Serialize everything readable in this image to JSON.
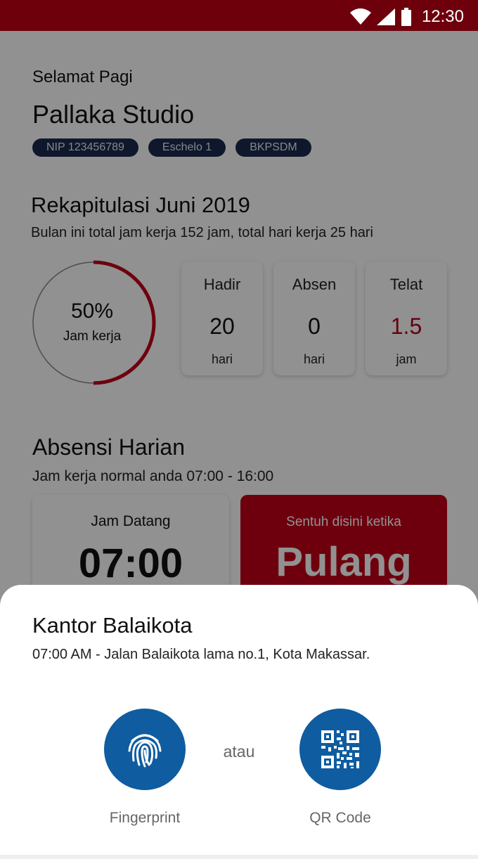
{
  "status_bar": {
    "time": "12:30",
    "background": "#6e000c"
  },
  "greeting": "Selamat Pagi",
  "user_name": "Pallaka Studio",
  "chips": [
    "NIP 123456789",
    "Eschelo 1",
    "BKPSDM"
  ],
  "rekap": {
    "title": "Rekapitulasi Juni 2019",
    "subtitle": "Bulan ini total jam kerja 152 jam, total hari kerja 25 hari",
    "progress_percent": 50,
    "progress_label": "50%",
    "progress_caption": "Jam kerja",
    "stats": [
      {
        "title": "Hadir",
        "value": "20",
        "unit": "hari"
      },
      {
        "title": "Absen",
        "value": "0",
        "unit": "hari"
      },
      {
        "title": "Telat",
        "value": "1.5",
        "unit": "jam"
      }
    ]
  },
  "absensi": {
    "title": "Absensi Harian",
    "subtitle": "Jam kerja normal anda 07:00 - 16:00",
    "datang_label": "Jam Datang",
    "datang_time": "07:00",
    "pulang_hint": "Sentuh disini ketika",
    "pulang_label": "Pulang"
  },
  "sheet": {
    "title": "Kantor Balaikota",
    "subtitle": "07:00 AM - Jalan Balaikota lama no.1, Kota Makassar.",
    "option_fingerprint": "Fingerprint",
    "separator": "atau",
    "option_qr": "QR Code"
  },
  "colors": {
    "accent_red": "#c10019",
    "primary_blue": "#0f5ca0",
    "chip_navy": "#1b2a4e"
  },
  "icons": [
    "wifi-icon",
    "signal-icon",
    "battery-icon",
    "fingerprint-icon",
    "qr-code-icon"
  ]
}
